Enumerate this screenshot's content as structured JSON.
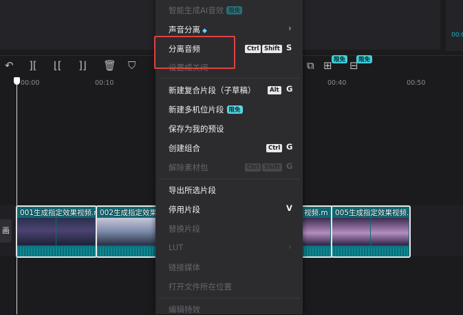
{
  "toolbar": {
    "tools": [
      "undo-icon",
      "split-icon",
      "split-left-icon",
      "split-right-icon",
      "delete-icon",
      "shield-icon"
    ],
    "right_badges": [
      "限免",
      "限免"
    ]
  },
  "timeline": {
    "ticks": [
      "00:00",
      "00:10",
      "00:40",
      "00:50"
    ],
    "track_label": "画",
    "right_timecode": "00:0",
    "clips": [
      {
        "title": "001生成指定效果视频.m"
      },
      {
        "title": "002生成指定效果"
      },
      {
        "title": "视频.m"
      },
      {
        "title": "005生成指定效果视频.m"
      }
    ]
  },
  "menu": {
    "items": [
      {
        "label": "智能生成AI音效",
        "badge": "限免",
        "disabled": true
      },
      {
        "label": "声音分离",
        "icon": "diamond-icon",
        "submenu": true
      },
      {
        "label": "分离音频",
        "modifiers": [
          "Ctrl",
          "Shift"
        ],
        "key": "S",
        "highlighted": true
      },
      {
        "label": "设置成关闭",
        "disabled": true
      },
      {
        "label": "新建复合片段（子草稿）",
        "modifiers": [
          "Alt"
        ],
        "key": "G"
      },
      {
        "label": "新建多机位片段",
        "badge": "限免"
      },
      {
        "label": "保存为我的预设"
      },
      {
        "label": "创建组合",
        "modifiers": [
          "Ctrl"
        ],
        "key": "G"
      },
      {
        "label": "解除素材包",
        "modifiers": [
          "Ctrl",
          "Shift"
        ],
        "key": "G",
        "disabled": true
      },
      {
        "label": "导出所选片段"
      },
      {
        "label": "停用片段",
        "key": "V"
      },
      {
        "label": "替换片段",
        "disabled": true
      },
      {
        "label": "LUT",
        "submenu": true,
        "disabled": true
      },
      {
        "label": "链接媒体",
        "disabled": true
      },
      {
        "label": "打开文件所在位置",
        "disabled": true
      },
      {
        "label": "编辑特效",
        "disabled": true
      }
    ]
  }
}
